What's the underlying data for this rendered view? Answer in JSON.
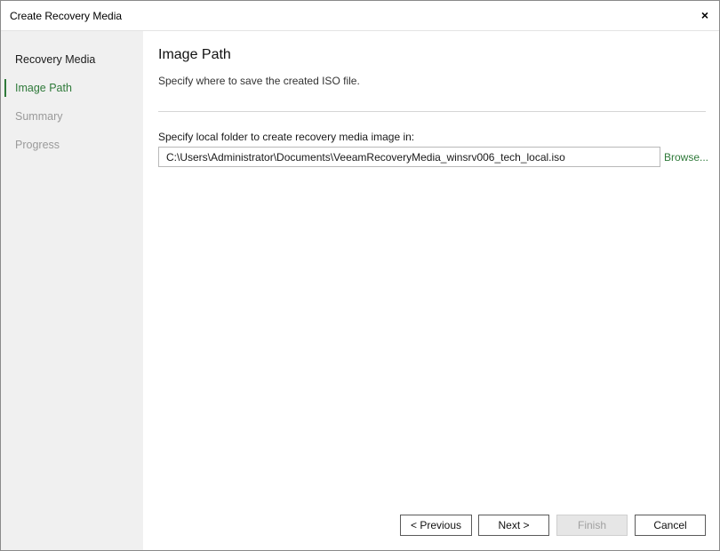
{
  "window": {
    "title": "Create Recovery Media",
    "close_glyph": "×"
  },
  "sidebar": {
    "steps": [
      {
        "label": "Recovery Media",
        "state": "done"
      },
      {
        "label": "Image Path",
        "state": "active"
      },
      {
        "label": "Summary",
        "state": "disabled"
      },
      {
        "label": "Progress",
        "state": "disabled"
      }
    ]
  },
  "main": {
    "title": "Image Path",
    "subtitle": "Specify where to save the created ISO file.",
    "field_label": "Specify local folder to create recovery media image in:",
    "path_value": "C:\\Users\\Administrator\\Documents\\VeeamRecoveryMedia_winsrv006_tech_local.iso",
    "browse_label": "Browse..."
  },
  "buttons": {
    "previous": "< Previous",
    "next": "Next >",
    "finish": "Finish",
    "cancel": "Cancel"
  },
  "colors": {
    "accent": "#2f7a3a",
    "sidebar_bg": "#f0f0f0",
    "disabled_text": "#9a9a9a"
  }
}
